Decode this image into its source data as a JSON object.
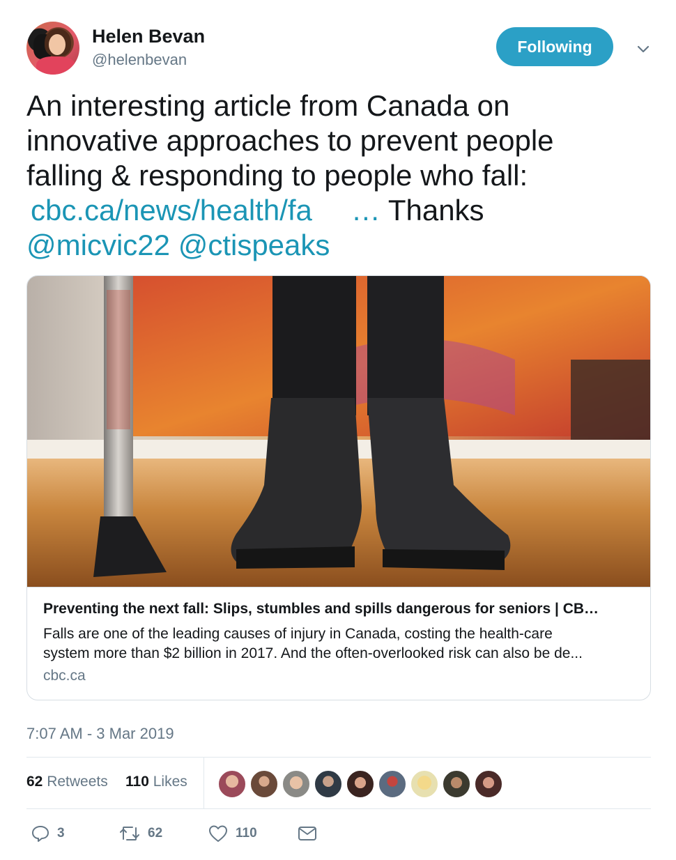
{
  "author": {
    "name": "Helen Bevan",
    "handle": "@helenbevan"
  },
  "follow_button": {
    "label": "Following"
  },
  "tweet": {
    "text_line1": "An interesting article from Canada on",
    "text_line2": "innovative approaches to prevent people",
    "text_line3": "falling & responding to people who fall:",
    "link": "cbc.ca/news/health/fa",
    "link_ellipsis": "…",
    "thanks": "Thanks",
    "mention1": "@micvic22",
    "mention2": "@ctispeaks"
  },
  "card": {
    "title": "Preventing the next fall: Slips, stumbles and spills dangerous for seniors | CB…",
    "description_line1": "Falls are one of the leading causes of injury in Canada, costing the health-care",
    "description_line2": "system more than $2 billion in 2017. And the often-overlooked risk can also be de...",
    "domain": "cbc.ca"
  },
  "timestamp": "7:07 AM - 3 Mar 2019",
  "stats": {
    "retweets_count": "62",
    "retweets_label": "Retweets",
    "likes_count": "110",
    "likes_label": "Likes"
  },
  "actions": {
    "reply_count": "3",
    "retweet_count": "62",
    "like_count": "110"
  },
  "colors": {
    "accent": "#2ba0c6",
    "link": "#1b95b5",
    "muted": "#657786"
  }
}
